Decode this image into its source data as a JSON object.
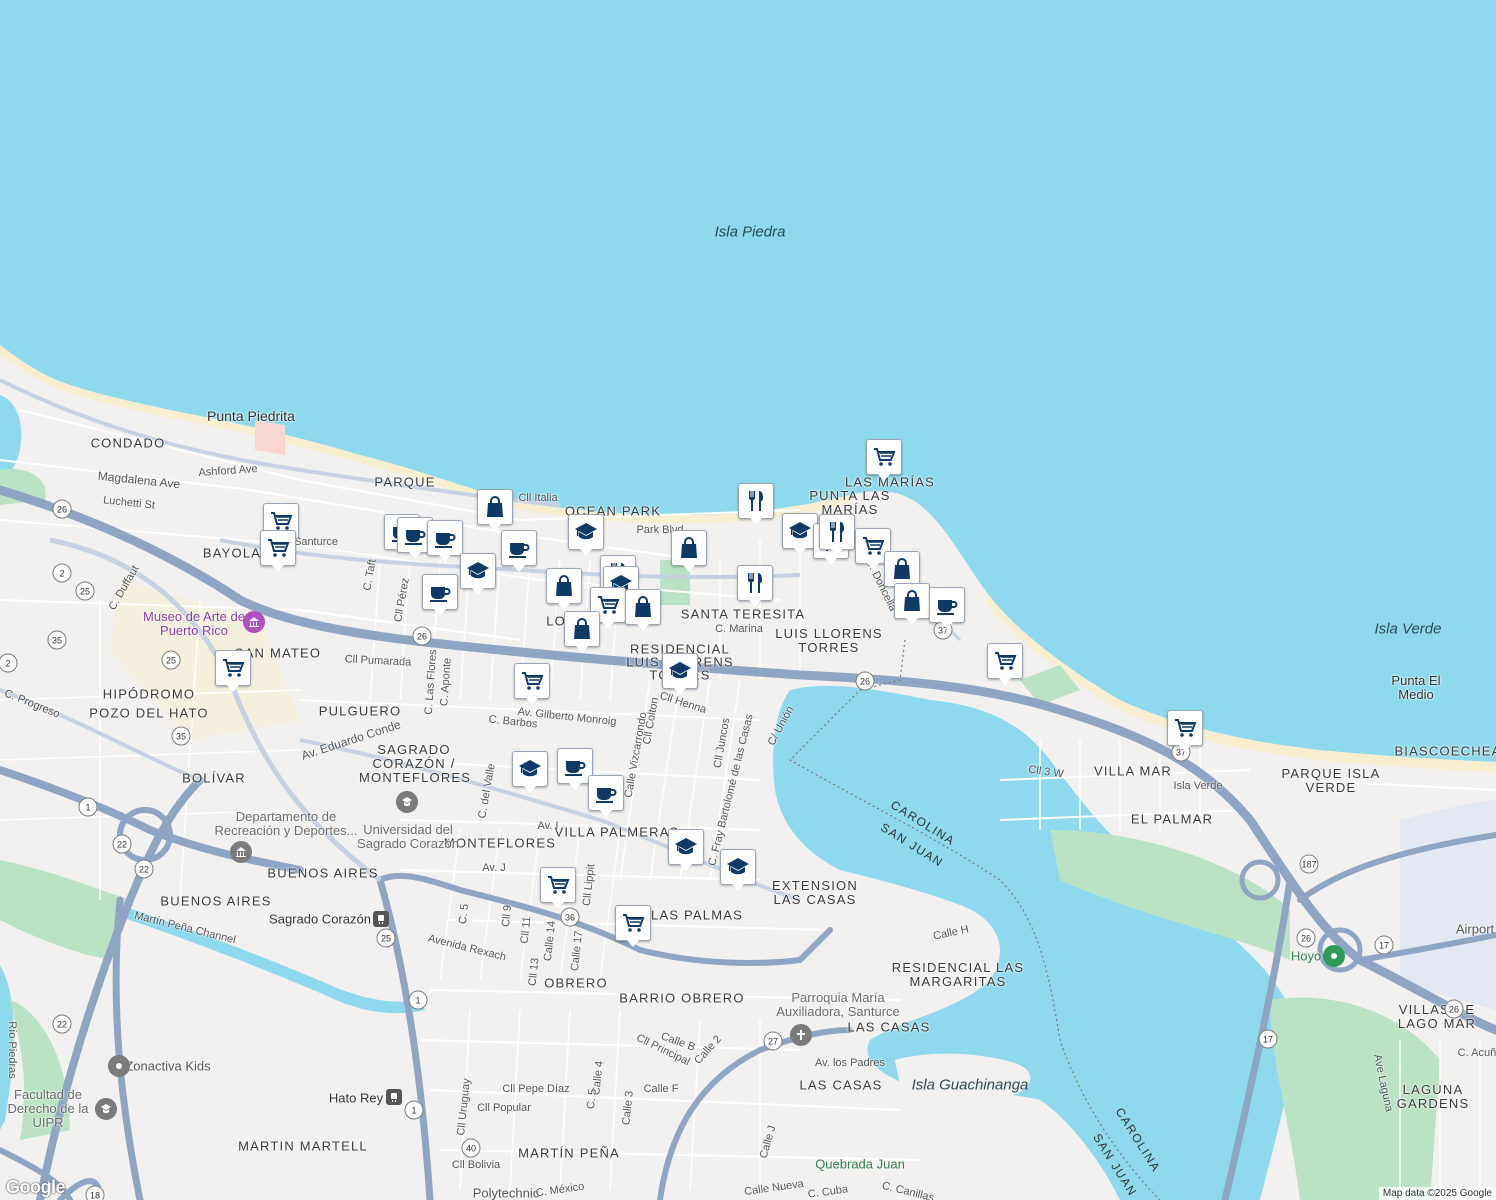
{
  "map": {
    "colors": {
      "water": "#8fd9ee",
      "land": "#f2f1ef",
      "highway": "#8ea6c4",
      "park": "#b9e3c4",
      "poi_marker": "#0d3a66",
      "beach": "#f7efd0"
    },
    "water_labels": [
      "Isla Piedra",
      "Isla Verde",
      "Isla Guachinanga"
    ],
    "neighborhoods": [
      "CONDADO",
      "PARQUE",
      "OCEAN PARK",
      "BAYOLA",
      "SANTA TERESITA",
      "LUIS LLORENS TORRES",
      "RESIDENCIAL LUIS LLORENS TORRES",
      "LAS MARÍAS",
      "PUNTA LAS MARÍAS",
      "SAN MATEO",
      "HIPÓDROMO",
      "POZO DEL HATO",
      "PULGUERO",
      "SAGRADO CORAZÓN / MONTEFLORES",
      "BOLÍVAR",
      "MONTEFLORES",
      "VILLA PALMERAS",
      "BUENOS AIRES",
      "EXTENSION LAS CASAS",
      "LAS PALMAS",
      "OBRERO",
      "BARRIO OBRERO",
      "RESIDENCIAL LAS MARGARITAS",
      "LAS CASAS",
      "MARTIN MARTELL",
      "MARTÍN PEÑA",
      "VILLA MAR",
      "EL PALMAR",
      "PARQUE ISLA VERDE",
      "BIASCOECHEA",
      "VILLAS DE LAGO MAR",
      "LAGUNA GARDENS",
      "LOÍZA"
    ],
    "places": [
      "Punta Piedrita",
      "Museo de Arte de Puerto Rico",
      "Universidad del Sagrado Corazón",
      "Departamento de Recreación y Deportes...",
      "Sagrado Corazón",
      "Zonactiva Kids",
      "Facultad de Derecho de la UIPR",
      "Hato Rey",
      "Parroquia María Auxiliadora, Santurce",
      "Quebrada Juan",
      "Hoyo",
      "Punta El Medio",
      "Polytechnic",
      "Airport",
      "Martín Peña Channel",
      "Río Piedras",
      "Santurce",
      "Isla Verde"
    ],
    "streets": [
      "Ashford Ave",
      "Magdalena Ave",
      "Luchetti St",
      "Cll Italia",
      "C. Duffaut",
      "C. Taft",
      "Cll Pérez",
      "C. Las Flores",
      "C. Aponte",
      "Cll Pumarada",
      "C. Progreso",
      "Av. Eduardo Conde",
      "Av. Gilberto Monroig",
      "C. Barbos",
      "Calle Vizcarrondo",
      "Cll Colton",
      "Cll Henna",
      "Cll Juncos",
      "C. Fray Bartolomé de las Casas",
      "C/ Unión",
      "C. Marina",
      "C. Doncella",
      "Cll 3 W",
      "Av. I",
      "Av. J",
      "C. 5",
      "Cll 9",
      "Cll 11",
      "Cll 13",
      "Calle 14",
      "Calle 17",
      "Cll Lippit",
      "Avenida Rexach",
      "Calle H",
      "Cll Principal",
      "Calle 2",
      "Calle B",
      "Av. los Padres",
      "Calle F",
      "Calle 4",
      "C. 5",
      "Calle 3",
      "Cll Pepe Díaz",
      "Cll Popular",
      "Cll Uruguay",
      "Cll Bolivia",
      "C. México",
      "Calle Nueva",
      "C. Cuba",
      "Calle J",
      "C. Canillas",
      "Park Blvd",
      "Ave Laguna",
      "C. Acuña",
      "C. del Valle"
    ],
    "boundary_labels": [
      "CAROLINA",
      "SAN JUAN"
    ],
    "route_shields": [
      "26",
      "2",
      "25",
      "35",
      "1",
      "22",
      "36",
      "37",
      "187",
      "17",
      "27",
      "40",
      "18"
    ],
    "markers": [
      {
        "type": "grocery-cart"
      },
      {
        "type": "grocery-cart"
      },
      {
        "type": "coffee"
      },
      {
        "type": "coffee"
      },
      {
        "type": "coffee"
      },
      {
        "type": "shopping-bag"
      },
      {
        "type": "coffee"
      },
      {
        "type": "school"
      },
      {
        "type": "school"
      },
      {
        "type": "shopping-bag"
      },
      {
        "type": "restaurant"
      },
      {
        "type": "school"
      },
      {
        "type": "grocery-cart"
      },
      {
        "type": "shopping-bag"
      },
      {
        "type": "shopping-bag"
      },
      {
        "type": "shopping-bag"
      },
      {
        "type": "restaurant"
      },
      {
        "type": "school"
      },
      {
        "type": "restaurant"
      },
      {
        "type": "restaurant"
      },
      {
        "type": "grocery-cart"
      },
      {
        "type": "restaurant"
      },
      {
        "type": "shopping-bag"
      },
      {
        "type": "shopping-bag"
      },
      {
        "type": "coffee"
      },
      {
        "type": "grocery-cart"
      },
      {
        "type": "grocery-cart"
      },
      {
        "type": "school"
      },
      {
        "type": "grocery-cart"
      },
      {
        "type": "school"
      },
      {
        "type": "coffee"
      },
      {
        "type": "coffee"
      },
      {
        "type": "school"
      },
      {
        "type": "school"
      },
      {
        "type": "grocery-cart"
      },
      {
        "type": "grocery-cart"
      },
      {
        "type": "grocery-cart"
      },
      {
        "type": "coffee"
      }
    ],
    "logo": "Google",
    "attribution": "Map data ©2025 Google"
  }
}
